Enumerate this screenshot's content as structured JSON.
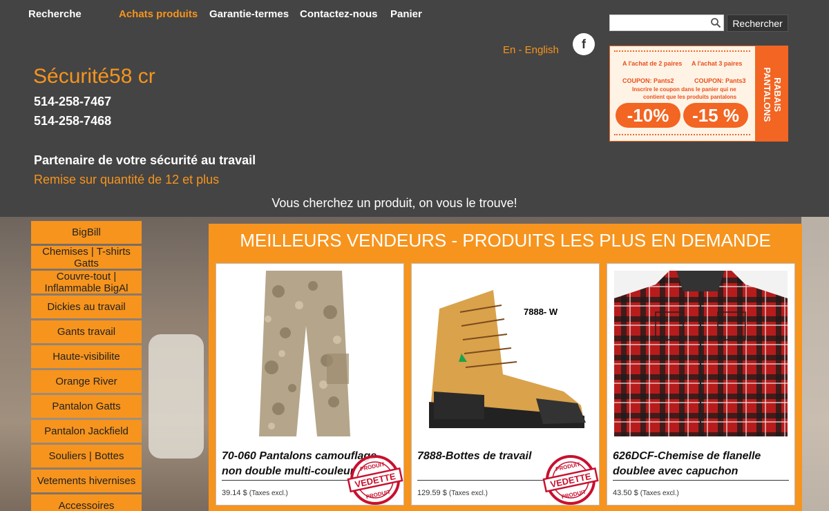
{
  "nav": {
    "search": "Recherche",
    "products": "Achats produits",
    "warranty": "Garantie-termes",
    "contact": "Contactez-nous",
    "cart": "Panier"
  },
  "search": {
    "value": "",
    "placeholder": "",
    "button_label": "Rechercher"
  },
  "language_link": "En - English",
  "promo": {
    "line1_left": "A l'achat de 2 paires",
    "line1_right": "A l'achat 3 paires",
    "coupon_left": "COUPON: Pants2",
    "coupon_right": "COUPON: Pants3",
    "note_line1": "Inscrire le coupon dans le panier qui ne",
    "note_line2": "contient que les produits pantalons",
    "discount_left": "-10%",
    "discount_right": "-15 %",
    "side_label_1": "RABAIS",
    "side_label_2": "PANTALONS"
  },
  "brand": {
    "title": "Sécurité58 cr",
    "phone1": "514-258-7467",
    "phone2": "514-258-7468",
    "tagline": "Partenaire de votre sécurité au travail",
    "discount": "Remise sur quantité de 12 et plus",
    "find_text": "Vous cherchez un produit, on vous le trouve!"
  },
  "sidebar": {
    "items": [
      {
        "label": "BigBill"
      },
      {
        "label": "Chemises | T-shirts Gatts"
      },
      {
        "label": "Couvre-tout | Inflammable BigAl"
      },
      {
        "label": "Dickies au travail"
      },
      {
        "label": "Gants travail"
      },
      {
        "label": "Haute-visibilite"
      },
      {
        "label": "Orange River"
      },
      {
        "label": "Pantalon Gatts"
      },
      {
        "label": "Pantalon Jackfield"
      },
      {
        "label": "Souliers | Bottes"
      },
      {
        "label": "Vetements hivernises"
      },
      {
        "label": "Accessoires"
      }
    ]
  },
  "featured": {
    "title": "MEILLEURS VENDEURS - PRODUITS LES PLUS EN DEMANDE",
    "badge_text_1": "PRODUIT",
    "badge_text_2": "VEDETTE",
    "products": [
      {
        "name": "70-060 Pantalons camouflage non double multi-couleur",
        "price": "39.14 $",
        "tax": "(Taxes excl.)",
        "featured": true
      },
      {
        "name": "7888-Bottes de travail",
        "price": "129.59 $",
        "tax": "(Taxes excl.)",
        "featured": true,
        "image_label": "7888- W"
      },
      {
        "name": "626DCF-Chemise de flanelle doublee avec capuchon",
        "price": "43.50 $",
        "tax": "(Taxes excl.)",
        "featured": false
      }
    ]
  },
  "colors": {
    "accent": "#f7941d",
    "header_bg": "#444444",
    "promo": "#f26522",
    "badge": "#c8102e"
  },
  "icons": {
    "search": "search-icon",
    "facebook": "facebook-icon"
  }
}
